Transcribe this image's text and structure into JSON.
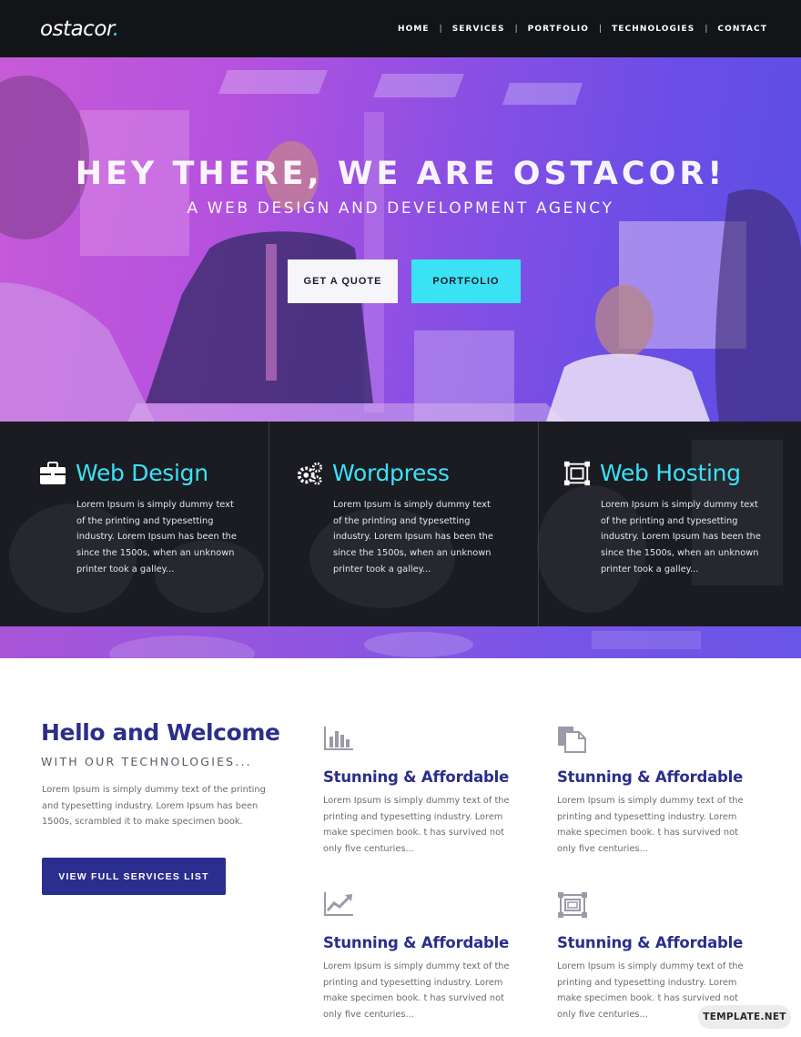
{
  "nav": {
    "logo": "ostacor",
    "logo_dot": ".",
    "items": [
      "HOME",
      "SERVICES",
      "PORTFOLIO",
      "TECHNOLOGIES",
      "CONTACT"
    ]
  },
  "hero": {
    "title": "HEY THERE, WE ARE OSTACOR!",
    "subtitle": "A WEB DESIGN AND DEVELOPMENT AGENCY",
    "quote_button": "GET A QUOTE",
    "portfolio_button": "PORTFOLIO"
  },
  "services": [
    {
      "title": "Web Design",
      "icon": "briefcase-icon",
      "text": "Lorem Ipsum is simply dummy text of the printing and typesetting industry. Lorem Ipsum has been the since the 1500s, when an unknown printer took a galley..."
    },
    {
      "title": "Wordpress",
      "icon": "gears-icon",
      "text": "Lorem Ipsum is simply dummy text of the printing and typesetting industry. Lorem Ipsum has been the since the 1500s, when an unknown printer took a galley..."
    },
    {
      "title": "Web Hosting",
      "icon": "hosting-frame-icon",
      "text": "Lorem Ipsum is simply dummy text of the printing and typesetting industry. Lorem Ipsum has been the since the 1500s, when an unknown printer took a galley..."
    }
  ],
  "welcome": {
    "title": "Hello and Welcome",
    "subtitle": "WITH OUR TECHNOLOGIES...",
    "text": "Lorem Ipsum is simply dummy text of the printing and typesetting industry. Lorem Ipsum has been 1500s, scrambled it to make specimen book.",
    "button": "VIEW FULL SERVICES LIST"
  },
  "features": [
    {
      "icon": "bar-chart-icon",
      "title": "Stunning & Affordable",
      "text": "Lorem Ipsum is simply dummy text of the printing and typesetting industry. Lorem make specimen book. t has survived not only five centuries..."
    },
    {
      "icon": "documents-icon",
      "title": "Stunning & Affordable",
      "text": "Lorem Ipsum is simply dummy text of the printing and typesetting industry. Lorem make specimen book. t has survived not only five centuries..."
    },
    {
      "icon": "line-chart-icon",
      "title": "Stunning & Affordable",
      "text": "Lorem Ipsum is simply dummy text of the printing and typesetting industry. Lorem make specimen book. t has survived not only five centuries..."
    },
    {
      "icon": "frame-icon",
      "title": "Stunning & Affordable",
      "text": "Lorem Ipsum is simply dummy text of the printing and typesetting industry. Lorem make specimen book. t has survived not only five centuries..."
    }
  ],
  "watermark": "TEMPLATE.NET",
  "colors": {
    "accent_cyan": "#3ae2f4",
    "brand_navy": "#2b2e8e",
    "nav_bg": "#121417",
    "hero_purple": "#b552de"
  }
}
